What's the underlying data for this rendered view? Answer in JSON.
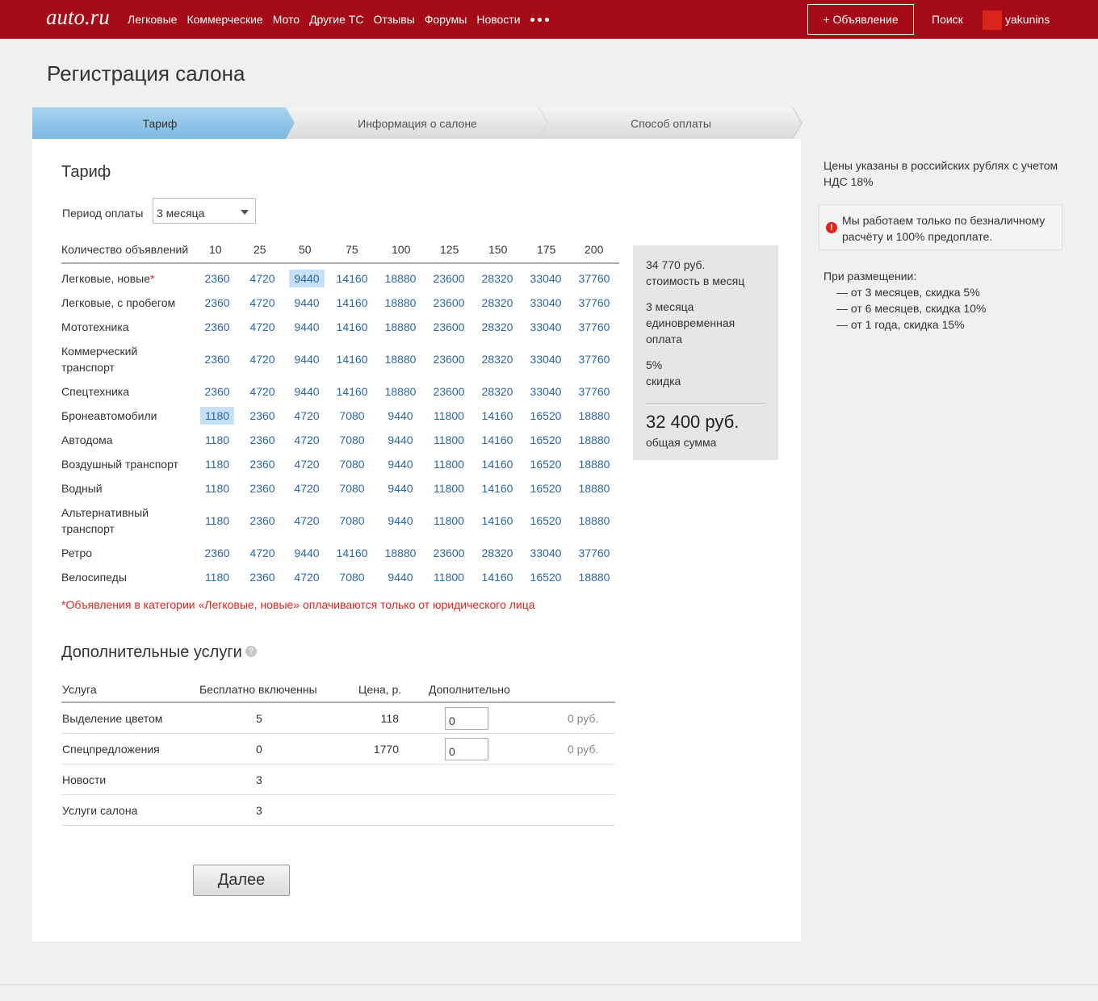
{
  "header": {
    "logo": "auto.ru",
    "nav": [
      "Легковые",
      "Коммерческие",
      "Мото",
      "Другие ТС",
      "Отзывы",
      "Форумы",
      "Новости"
    ],
    "more_icon": "more-dots-icon",
    "add_button": "+ Объявление",
    "search": "Поиск",
    "user": "yakunins"
  },
  "page_title": "Регистрация салона",
  "steps": [
    "Тариф",
    "Информация о салоне",
    "Способ оплаты"
  ],
  "tariff": {
    "heading": "Тариф",
    "period_label": "Период оплаты",
    "period_value": "3 месяца",
    "count_label": "Количество объявлений",
    "counts": [
      "10",
      "25",
      "50",
      "75",
      "100",
      "125",
      "150",
      "175",
      "200"
    ],
    "rows": [
      {
        "label": "Легковые, новые",
        "star": "*",
        "prices": [
          "2360",
          "4720",
          "9440",
          "14160",
          "18880",
          "23600",
          "28320",
          "33040",
          "37760"
        ]
      },
      {
        "label": "Легковые, с пробегом",
        "prices": [
          "2360",
          "4720",
          "9440",
          "14160",
          "18880",
          "23600",
          "28320",
          "33040",
          "37760"
        ]
      },
      {
        "label": "Мототехника",
        "prices": [
          "2360",
          "4720",
          "9440",
          "14160",
          "18880",
          "23600",
          "28320",
          "33040",
          "37760"
        ]
      },
      {
        "label": "Коммерческий транспорт",
        "prices": [
          "2360",
          "4720",
          "9440",
          "14160",
          "18880",
          "23600",
          "28320",
          "33040",
          "37760"
        ]
      },
      {
        "label": "Спецтехника",
        "prices": [
          "2360",
          "4720",
          "9440",
          "14160",
          "18880",
          "23600",
          "28320",
          "33040",
          "37760"
        ]
      },
      {
        "label": "Бронеавтомобили",
        "prices": [
          "1180",
          "2360",
          "4720",
          "7080",
          "9440",
          "11800",
          "14160",
          "16520",
          "18880"
        ]
      },
      {
        "label": "Автодома",
        "prices": [
          "1180",
          "2360",
          "4720",
          "7080",
          "9440",
          "11800",
          "14160",
          "16520",
          "18880"
        ]
      },
      {
        "label": "Воздушный транспорт",
        "prices": [
          "1180",
          "2360",
          "4720",
          "7080",
          "9440",
          "11800",
          "14160",
          "16520",
          "18880"
        ]
      },
      {
        "label": "Водный",
        "prices": [
          "1180",
          "2360",
          "4720",
          "7080",
          "9440",
          "11800",
          "14160",
          "16520",
          "18880"
        ]
      },
      {
        "label": "Альтернативный транспорт",
        "prices": [
          "1180",
          "2360",
          "4720",
          "7080",
          "9440",
          "11800",
          "14160",
          "16520",
          "18880"
        ]
      },
      {
        "label": "Ретро",
        "prices": [
          "2360",
          "4720",
          "9440",
          "14160",
          "18880",
          "23600",
          "28320",
          "33040",
          "37760"
        ]
      },
      {
        "label": "Велосипеды",
        "prices": [
          "1180",
          "2360",
          "4720",
          "7080",
          "9440",
          "11800",
          "14160",
          "16520",
          "18880"
        ]
      }
    ],
    "selected": [
      {
        "row": 0,
        "col": 2
      },
      {
        "row": 5,
        "col": 0
      }
    ],
    "note_star": "*",
    "note": "Объявления в категории «Легковые, новые» оплачиваются только от юридического лица"
  },
  "summary": {
    "monthly": "34 770 руб.",
    "monthly_label": "стоимость в месяц",
    "period": "3 месяца",
    "period_label1": "единовременная",
    "period_label2": "оплата",
    "discount": "5%",
    "discount_label": "скидка",
    "total": "32 400 руб.",
    "total_label": "общая сумма"
  },
  "services": {
    "heading": "Дополнительные услуги",
    "help_icon": "?",
    "columns": [
      "Услуга",
      "Бесплатно включенны",
      "Цена, р.",
      "Дополнительно"
    ],
    "rows": [
      {
        "name": "Выделение цветом",
        "free": "5",
        "price": "118",
        "extra": "0",
        "sum": "0 руб."
      },
      {
        "name": "Спецпредложения",
        "free": "0",
        "price": "1770",
        "extra": "0",
        "sum": "0 руб."
      },
      {
        "name": "Новости",
        "free": "3"
      },
      {
        "name": "Услуги салона",
        "free": "3"
      }
    ]
  },
  "next_button": "Далее",
  "side": {
    "vat": "Цены указаны в российских рублях с учетом НДС 18%",
    "alert_icon": "!",
    "alert": "Мы работаем только по безналичному расчёту и 100% предоплате.",
    "discount_title": "При размещении:",
    "discounts": [
      "— от 3 месяцев, скидка 5%",
      "— от 6 месяцев, скидка 10%",
      "— от 1 года, скидка 15%"
    ]
  },
  "colors": {
    "brand": "#a40b17",
    "link": "#2c66a8",
    "active_step": "#8cc3e6",
    "selected_cell": "#c6e0f7",
    "warning": "#e3231c"
  }
}
